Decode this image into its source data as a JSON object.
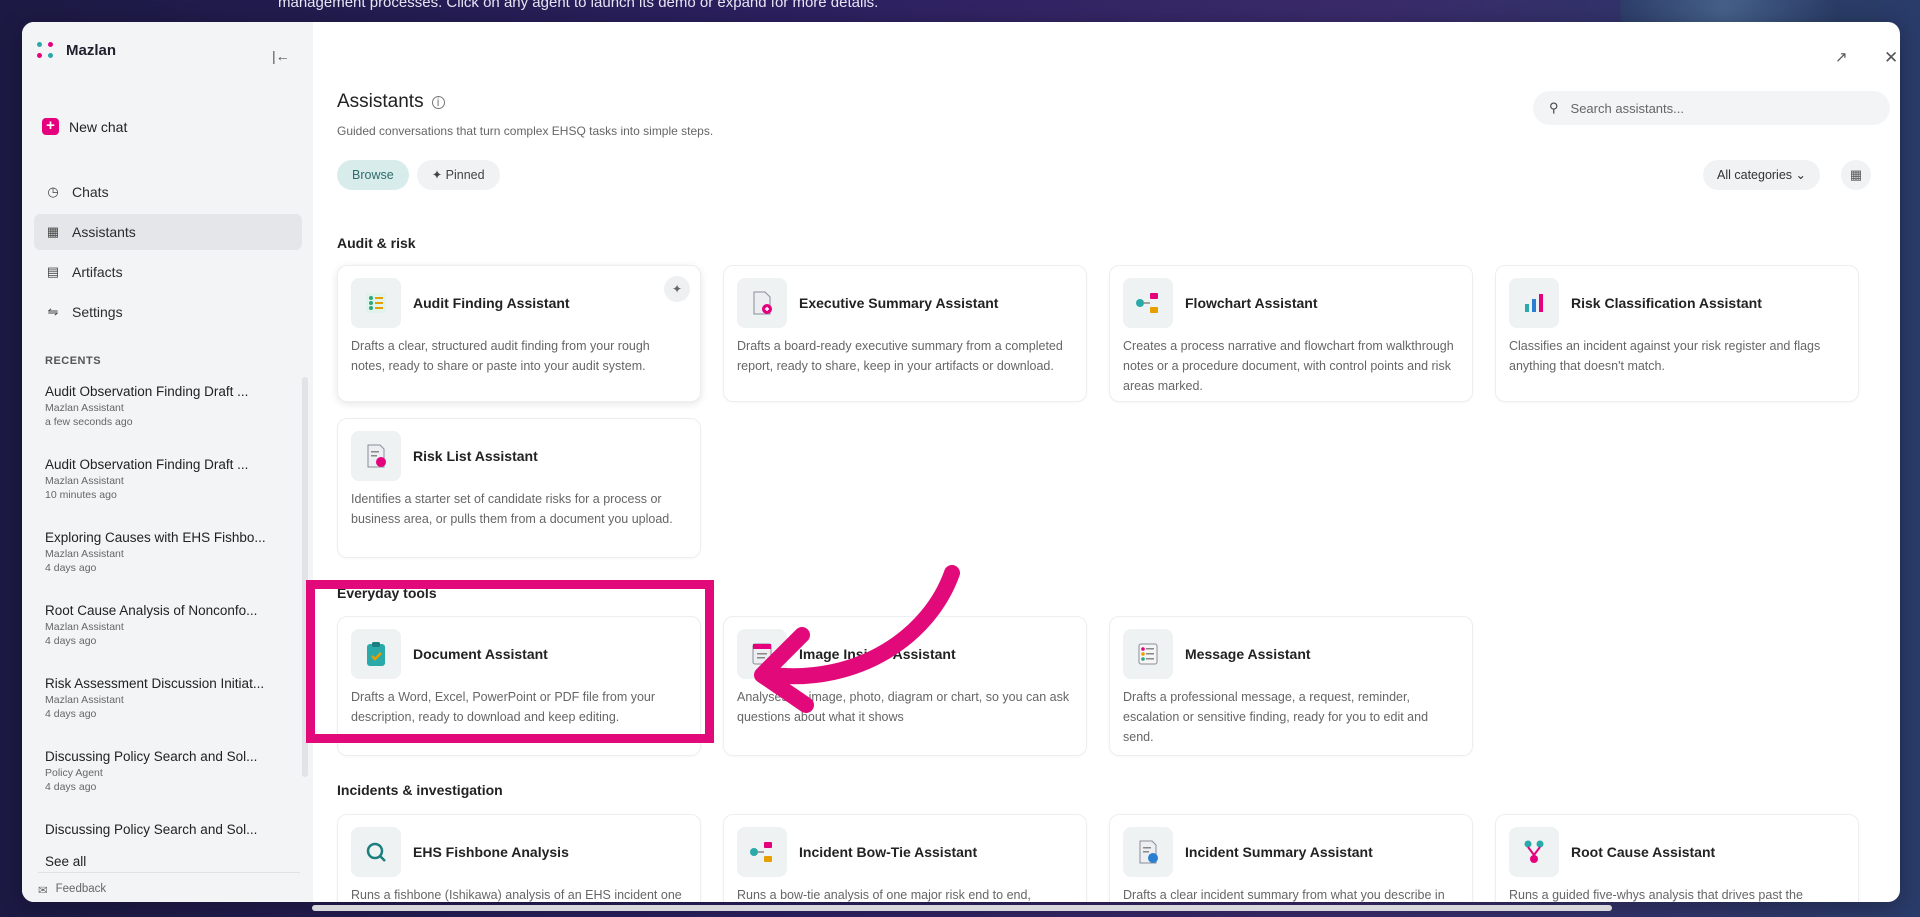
{
  "banner": {
    "text": "management processes. Click on any agent to launch its demo or expand for more details."
  },
  "sidebar": {
    "app_name": "Mazlan",
    "new_chat": "New chat",
    "nav": [
      {
        "label": "Chats",
        "icon": "chat-icon"
      },
      {
        "label": "Assistants",
        "icon": "grid-icon"
      },
      {
        "label": "Artifacts",
        "icon": "document-icon"
      },
      {
        "label": "Settings",
        "icon": "sliders-icon"
      }
    ],
    "recents_heading": "RECENTS",
    "recents": [
      {
        "title": "Audit Observation Finding Draft ...",
        "source": "Mazlan Assistant",
        "time": "a few seconds ago"
      },
      {
        "title": "Audit Observation Finding Draft ...",
        "source": "Mazlan Assistant",
        "time": "10 minutes ago"
      },
      {
        "title": "Exploring Causes with EHS Fishbo...",
        "source": "Mazlan Assistant",
        "time": "4 days ago"
      },
      {
        "title": "Root Cause Analysis of Nonconfo...",
        "source": "Mazlan Assistant",
        "time": "4 days ago"
      },
      {
        "title": "Risk Assessment Discussion Initiat...",
        "source": "Mazlan Assistant",
        "time": "4 days ago"
      },
      {
        "title": "Discussing Policy Search and Sol...",
        "source": "Policy Agent",
        "time": "4 days ago"
      },
      {
        "title": "Discussing Policy Search and Sol...",
        "source": "",
        "time": ""
      }
    ],
    "see_all": "See all",
    "feedback": "Feedback"
  },
  "main": {
    "title": "Assistants",
    "subtitle": "Guided conversations that turn complex EHSQ tasks into simple steps.",
    "search_placeholder": "Search assistants...",
    "tabs": [
      {
        "label": "Browse",
        "active": true
      },
      {
        "label": "Pinned",
        "active": false
      }
    ],
    "category_select": "All categories",
    "sections": [
      {
        "title": "Audit & risk",
        "cards": [
          {
            "name": "Audit Finding Assistant",
            "desc": "Drafts a clear, structured audit finding from your rough notes, ready to share or paste into your audit system.",
            "icon": "checklist-icon"
          },
          {
            "name": "Executive Summary Assistant",
            "desc": "Drafts a board-ready executive summary from a completed report, ready to share, keep in your artifacts or download.",
            "icon": "report-icon"
          },
          {
            "name": "Flowchart Assistant",
            "desc": "Creates a process narrative and flowchart from walkthrough notes or a procedure document, with control points and risk areas marked.",
            "icon": "flowchart-icon"
          },
          {
            "name": "Risk Classification Assistant",
            "desc": "Classifies an incident against your risk register and flags anything that doesn't match.",
            "icon": "bar-chart-icon"
          },
          {
            "name": "Risk List Assistant",
            "desc": "Identifies a starter set of candidate risks for a process or business area, or pulls them from a document you upload.",
            "icon": "risk-list-icon"
          }
        ]
      },
      {
        "title": "Everyday tools",
        "cards": [
          {
            "name": "Document Assistant",
            "desc": "Drafts a Word, Excel, PowerPoint or PDF file from your description, ready to download and keep editing.",
            "icon": "clipboard-icon"
          },
          {
            "name": "Image Insight Assistant",
            "desc": "Analyses an image, photo, diagram or chart, so you can ask questions about what it shows",
            "icon": "image-icon"
          },
          {
            "name": "Message Assistant",
            "desc": "Drafts a professional message, a request, reminder, escalation or sensitive finding, ready for you to edit and send.",
            "icon": "message-icon"
          }
        ]
      },
      {
        "title": "Incidents & investigation",
        "cards": [
          {
            "name": "EHS Fishbone Analysis",
            "desc": "Runs a fishbone (Ishikawa) analysis of an EHS incident one question at a time, and draws it as a diagram.",
            "icon": "magnifier-icon"
          },
          {
            "name": "Incident Bow-Tie Assistant",
            "desc": "Runs a bow-tie analysis of one major risk end to end, threats, barriers and consequences, drawn as a",
            "icon": "bowtie-icon"
          },
          {
            "name": "Incident Summary Assistant",
            "desc": "Drafts a clear incident summary from what you describe in your own words, ready to review and share.",
            "icon": "summary-icon"
          },
          {
            "name": "Root Cause Assistant",
            "desc": "Runs a guided five-whys analysis that drives past the symptoms to the underlying root cause.",
            "icon": "root-cause-icon"
          }
        ]
      }
    ]
  },
  "colors": {
    "accent": "#e5007e",
    "teal": "#2aa9a9",
    "highlight": "#e20a7a"
  }
}
